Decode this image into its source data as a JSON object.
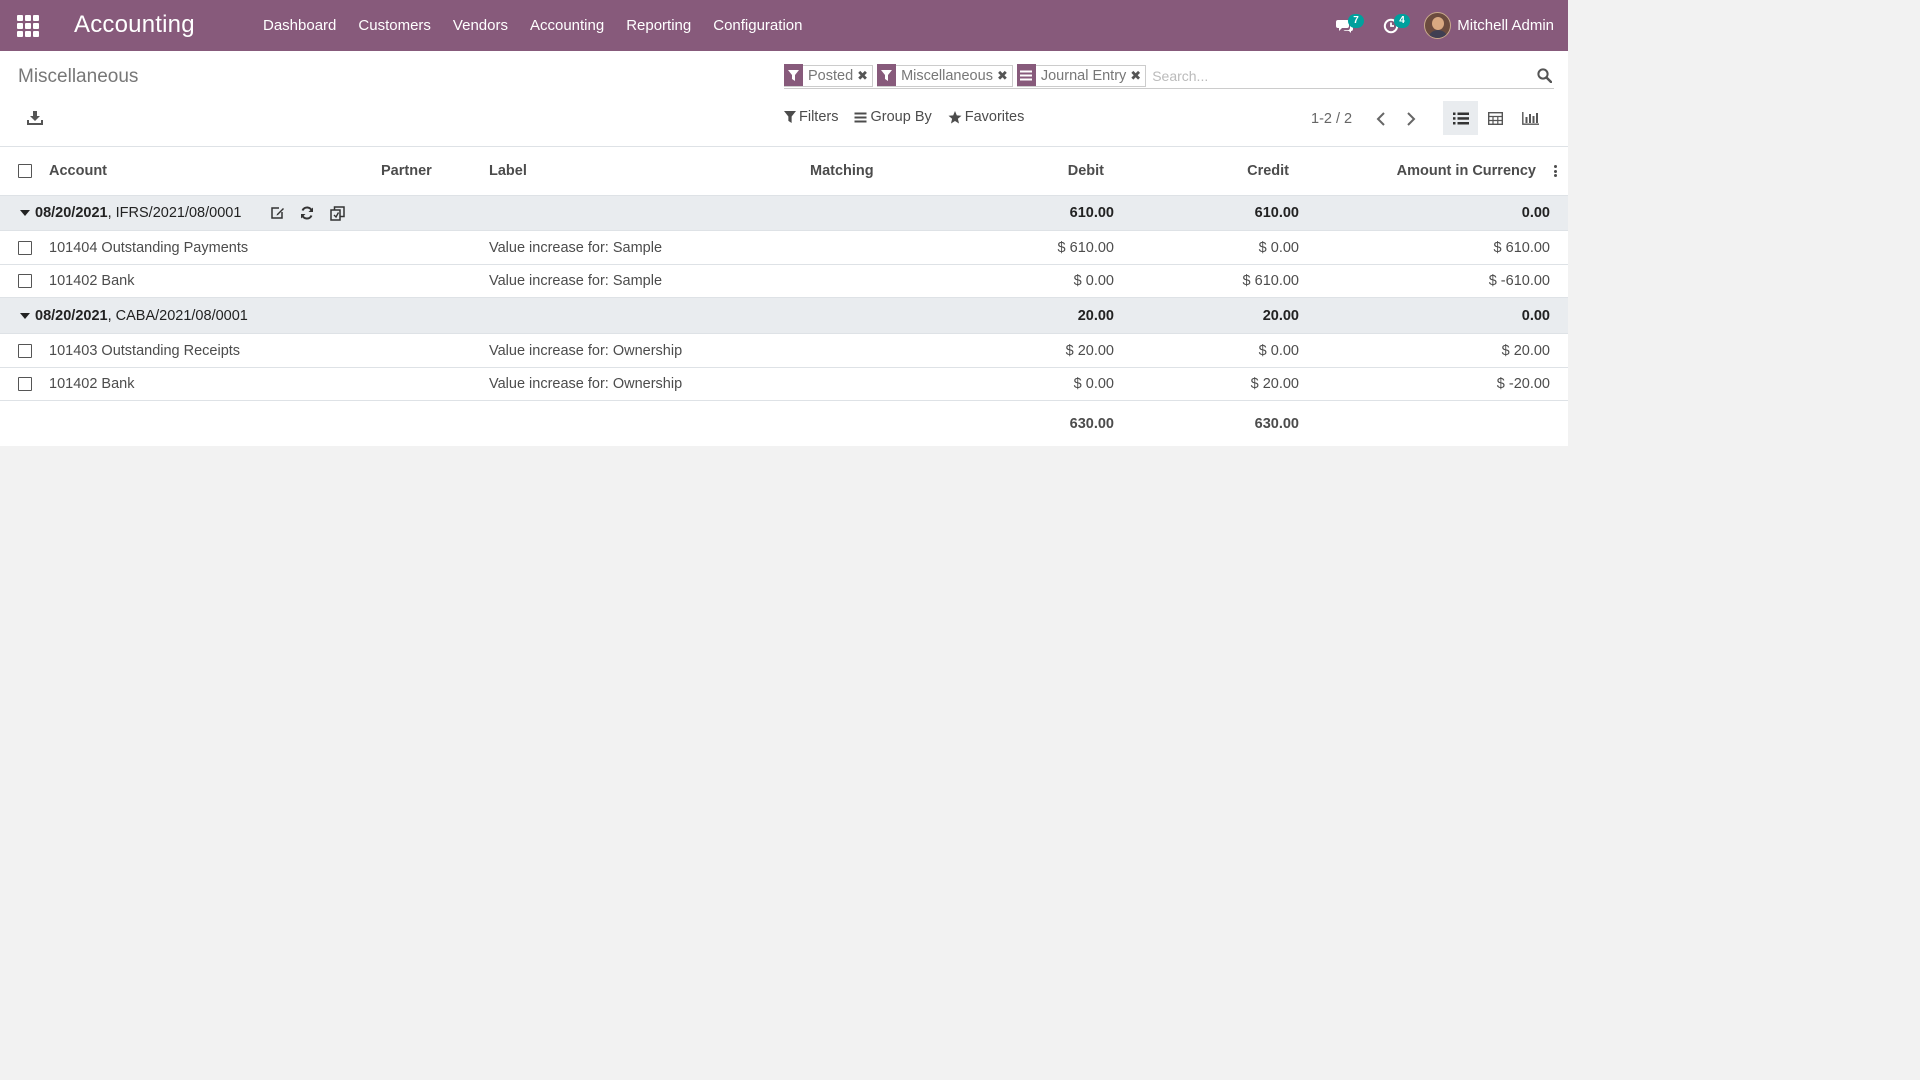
{
  "navbar": {
    "brand": "Accounting",
    "menu": [
      "Dashboard",
      "Customers",
      "Vendors",
      "Accounting",
      "Reporting",
      "Configuration"
    ],
    "messages_count": "7",
    "activities_count": "4",
    "user_name": "Mitchell Admin"
  },
  "control_panel": {
    "breadcrumb": "Miscellaneous",
    "facets": [
      {
        "type": "filter",
        "value": "Posted"
      },
      {
        "type": "filter",
        "value": "Miscellaneous"
      },
      {
        "type": "groupby",
        "value": "Journal Entry"
      }
    ],
    "search_placeholder": "Search...",
    "filters_label": "Filters",
    "groupby_label": "Group By",
    "favorites_label": "Favorites",
    "pager_value": "1-2 / 2"
  },
  "table": {
    "columns": {
      "account": "Account",
      "partner": "Partner",
      "label": "Label",
      "matching": "Matching",
      "debit": "Debit",
      "credit": "Credit",
      "amount_currency": "Amount in Currency"
    },
    "groups": [
      {
        "date": "08/20/2021",
        "ref": ", IFRS/2021/08/0001",
        "debit": "610.00",
        "credit": "610.00",
        "amount_currency": "0.00",
        "lines": [
          {
            "account": "101404 Outstanding Payments",
            "partner": "",
            "label": "Value increase for: Sample",
            "matching": "",
            "debit": "$ 610.00",
            "credit": "$ 0.00",
            "amount_currency": "$ 610.00"
          },
          {
            "account": "101402 Bank",
            "partner": "",
            "label": "Value increase for: Sample",
            "matching": "",
            "debit": "$ 0.00",
            "credit": "$ 610.00",
            "amount_currency": "$ -610.00"
          }
        ]
      },
      {
        "date": "08/20/2021",
        "ref": ", CABA/2021/08/0001",
        "debit": "20.00",
        "credit": "20.00",
        "amount_currency": "0.00",
        "lines": [
          {
            "account": "101403 Outstanding Receipts",
            "partner": "",
            "label": "Value increase for: Ownership",
            "matching": "",
            "debit": "$ 20.00",
            "credit": "$ 0.00",
            "amount_currency": "$ 20.00"
          },
          {
            "account": "101402 Bank",
            "partner": "",
            "label": "Value increase for: Ownership",
            "matching": "",
            "debit": "$ 0.00",
            "credit": "$ 20.00",
            "amount_currency": "$ -20.00"
          }
        ]
      }
    ],
    "totals": {
      "debit": "630.00",
      "credit": "630.00"
    }
  },
  "colors": {
    "brand": "#875a7b",
    "badge": "#00a09d",
    "group_bg": "#e9ecef"
  }
}
